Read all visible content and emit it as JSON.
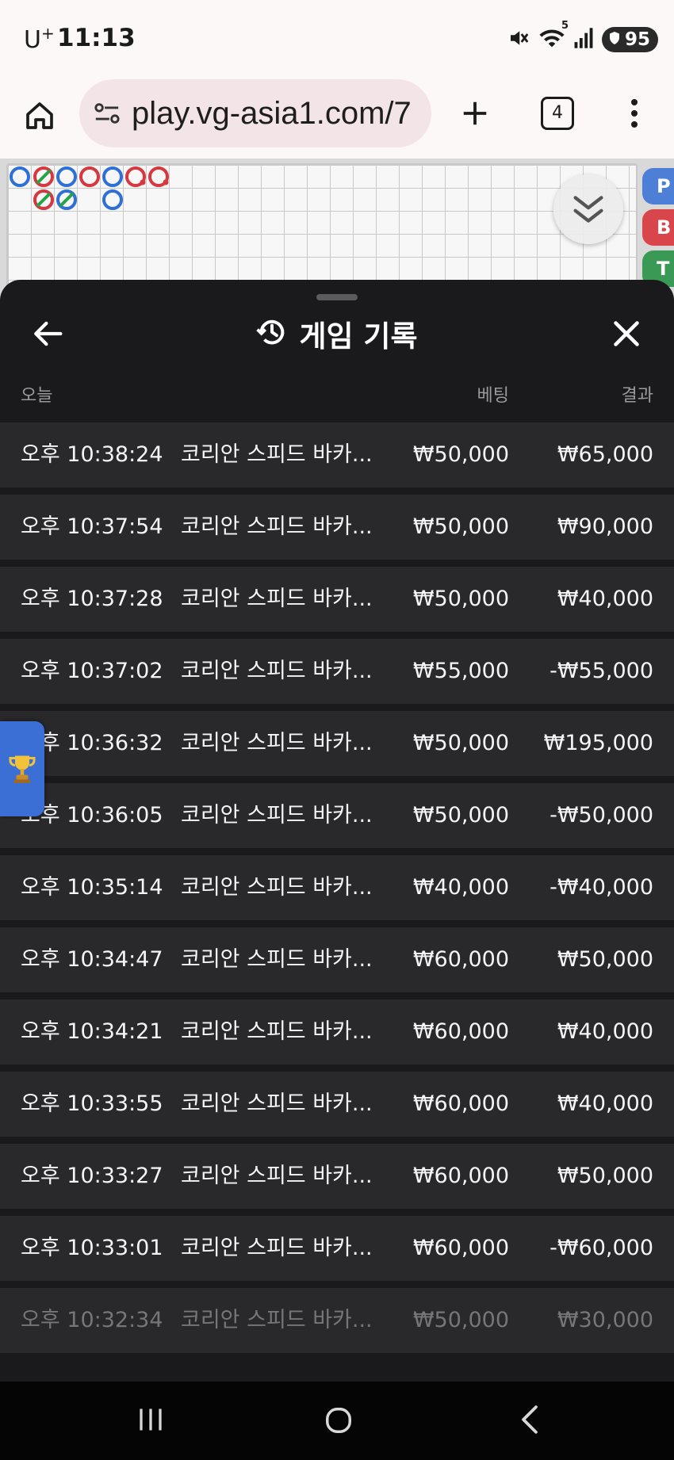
{
  "status_bar": {
    "carrier": "U",
    "carrier_sup": "+",
    "time": "11:13",
    "wifi_badge": "5",
    "battery": "95"
  },
  "browser": {
    "url": "play.vg-asia1.com/7",
    "tab_count": "4"
  },
  "side_tabs": {
    "p": "P",
    "b": "B",
    "t": "T"
  },
  "history": {
    "title": "게임 기록",
    "col_today": "오늘",
    "col_bet": "베팅",
    "col_result": "결과",
    "rows": [
      {
        "time": "오후 10:38:24",
        "game": "코리안 스피드 바카...",
        "bet": "₩50,000",
        "result": "₩65,000"
      },
      {
        "time": "오후 10:37:54",
        "game": "코리안 스피드 바카...",
        "bet": "₩50,000",
        "result": "₩90,000"
      },
      {
        "time": "오후 10:37:28",
        "game": "코리안 스피드 바카...",
        "bet": "₩50,000",
        "result": "₩40,000"
      },
      {
        "time": "오후 10:37:02",
        "game": "코리안 스피드 바카...",
        "bet": "₩55,000",
        "result": "-₩55,000"
      },
      {
        "time": "오후 10:36:32",
        "game": "코리안 스피드 바카...",
        "bet": "₩50,000",
        "result": "₩195,000"
      },
      {
        "time": "오후 10:36:05",
        "game": "코리안 스피드 바카...",
        "bet": "₩50,000",
        "result": "-₩50,000"
      },
      {
        "time": "오후 10:35:14",
        "game": "코리안 스피드 바카...",
        "bet": "₩40,000",
        "result": "-₩40,000"
      },
      {
        "time": "오후 10:34:47",
        "game": "코리안 스피드 바카...",
        "bet": "₩60,000",
        "result": "₩50,000"
      },
      {
        "time": "오후 10:34:21",
        "game": "코리안 스피드 바카...",
        "bet": "₩60,000",
        "result": "₩40,000"
      },
      {
        "time": "오후 10:33:55",
        "game": "코리안 스피드 바카...",
        "bet": "₩60,000",
        "result": "₩40,000"
      },
      {
        "time": "오후 10:33:27",
        "game": "코리안 스피드 바카...",
        "bet": "₩60,000",
        "result": "₩50,000"
      },
      {
        "time": "오후 10:33:01",
        "game": "코리안 스피드 바카...",
        "bet": "₩60,000",
        "result": "-₩60,000"
      },
      {
        "time": "오후 10:32:34",
        "game": "코리안 스피드 바카...",
        "bet": "₩50,000",
        "result": "₩30,000"
      }
    ]
  },
  "colors": {
    "sheet_bg": "#1a1a1c",
    "row_bg": "#29292c",
    "player_blue": "#2f6fd8",
    "banker_red": "#d7383f",
    "tie_green": "#22a447",
    "trophy_tab": "#3b6fd6"
  }
}
